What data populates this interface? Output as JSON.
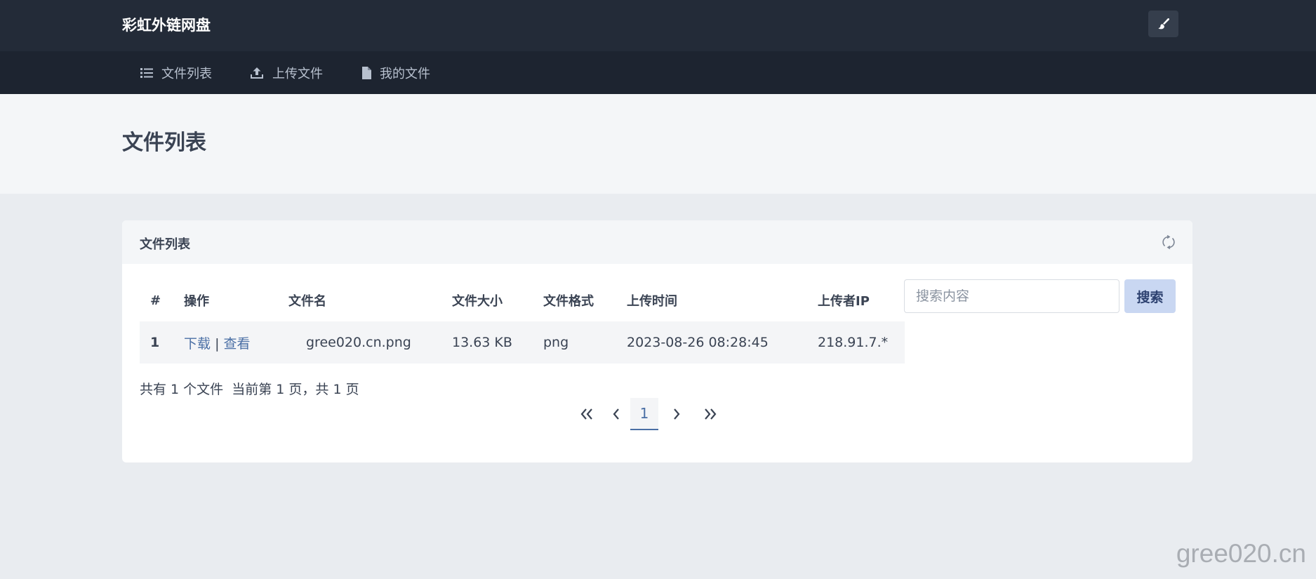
{
  "app": {
    "brand": "彩虹外链网盘"
  },
  "nav": {
    "items": [
      {
        "label": "文件列表",
        "icon": "list-icon"
      },
      {
        "label": "上传文件",
        "icon": "upload-icon"
      },
      {
        "label": "我的文件",
        "icon": "file-icon"
      }
    ]
  },
  "page": {
    "title": "文件列表"
  },
  "card": {
    "title": "文件列表",
    "table": {
      "headers": [
        "#",
        "操作",
        "文件名",
        "文件大小",
        "文件格式",
        "上传时间",
        "上传者IP"
      ],
      "rows": [
        {
          "index": "1",
          "action_download": "下载",
          "action_sep": "|",
          "action_view": "查看",
          "filename": "gree020.cn.png",
          "size": "13.63 KB",
          "format": "png",
          "time": "2023-08-26 08:28:45",
          "ip": "218.91.7.*"
        }
      ]
    },
    "search": {
      "placeholder": "搜索内容",
      "button": "搜索"
    },
    "summary": "共有 1 个文件  当前第 1 页，共 1 页",
    "pagination": {
      "current": "1"
    }
  },
  "watermark": "gree020.cn",
  "colors": {
    "topbar": "#232b38",
    "navbar": "#1d2430",
    "link": "#4a6fa5",
    "search_button": "#c9d7f2"
  }
}
